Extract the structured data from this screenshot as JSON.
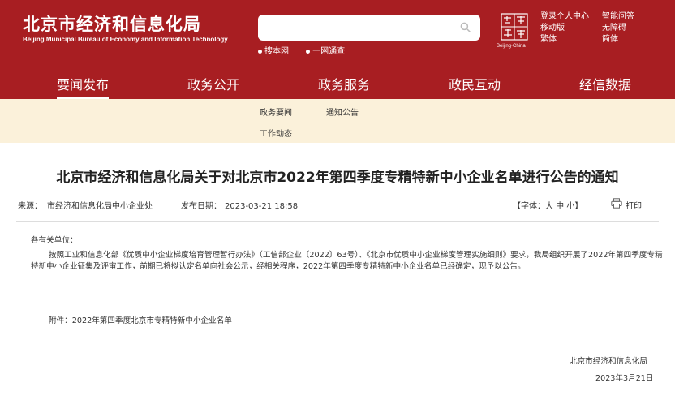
{
  "header": {
    "title_cn": "北京市经济和信息化局",
    "title_en": "Beijing Municipal Bureau of Economy and Information Technology",
    "search_options": [
      "搜本网",
      "一网通查"
    ],
    "capital_logo_text": "Beijing·China",
    "top_links_col1": [
      "登录个人中心",
      "移动版",
      "繁体"
    ],
    "top_links_col2": [
      "智能问答",
      "无障碍",
      "简体"
    ]
  },
  "nav": {
    "items": [
      "要闻发布",
      "政务公开",
      "政务服务",
      "政民互动",
      "经信数据"
    ],
    "active_index": 0
  },
  "subnav": {
    "items": [
      "政务要闻",
      "通知公告",
      "工作动态"
    ]
  },
  "article": {
    "title": "北京市经济和信息化局关于对北京市2022年第四季度专精特新中小企业名单进行公告的通知",
    "source_label": "来源：",
    "source": "市经济和信息化局中小企业处",
    "date_label": "发布日期：",
    "date": "2023-03-21 18:58",
    "font_size_label": "【字体：大 中 小】",
    "print_label": "打印",
    "salutation": "各有关单位：",
    "paragraph": "按照工业和信息化部《优质中小企业梯度培育管理暂行办法》（工信部企业〔2022〕63号）、《北京市优质中小企业梯度管理实施细则》要求，我局组织开展了2022年第四季度专精特新中小企业征集及评审工作，前期已将拟认定名单向社会公示，经相关程序，2022年第四季度专精特新中小企业名单已经确定，现予以公告。",
    "attachment": "附件：2022年第四季度北京市专精特新中小企业名单",
    "signature_org": "北京市经济和信息化局",
    "signature_date": "2023年3月21日"
  },
  "colors": {
    "header_red": "#a81e22",
    "subnav_bg": "#fbf1da"
  }
}
